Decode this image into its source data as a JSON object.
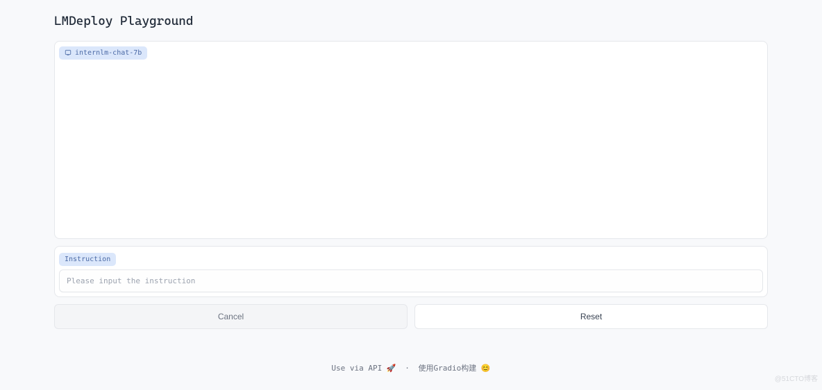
{
  "header": {
    "title": "LMDeploy Playground"
  },
  "chat": {
    "model_badge": "internlm-chat-7b"
  },
  "instruction": {
    "label": "Instruction",
    "placeholder": "Please input the instruction"
  },
  "buttons": {
    "cancel": "Cancel",
    "reset": "Reset"
  },
  "footer": {
    "api_text": "Use via API",
    "api_emoji": "🚀",
    "separator": "·",
    "gradio_text": "使用Gradio构建",
    "gradio_emoji": "😊"
  },
  "watermark": "@51CTO博客"
}
